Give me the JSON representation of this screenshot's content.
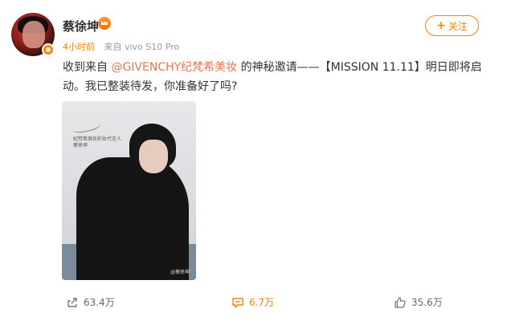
{
  "post": {
    "username": "蔡徐坤",
    "time": "4小时前",
    "source": "来自 vivo S10 Pro",
    "follow_label": "关注",
    "text_part1": "收到来自",
    "mention": "@GIVENCHY纪梵希美妆",
    "text_part2": "的神秘邀请——【MISSION 11.11】明日即将启动。我已整装待发，你准备好了吗?",
    "image": {
      "caption_line1": "纪梵希美妆彩妆代言人",
      "caption_line2": "蔡徐坤",
      "watermark": "@蔡徐坤"
    }
  },
  "actions": {
    "share_count": "63.4万",
    "comment_count": "6.7万",
    "like_count": "35.6万"
  },
  "colors": {
    "accent": "#ff8200",
    "mention": "#eb7350"
  },
  "icons": [
    "vip-badge-icon",
    "crown-badge-icon",
    "share-icon",
    "comment-icon",
    "like-icon"
  ]
}
